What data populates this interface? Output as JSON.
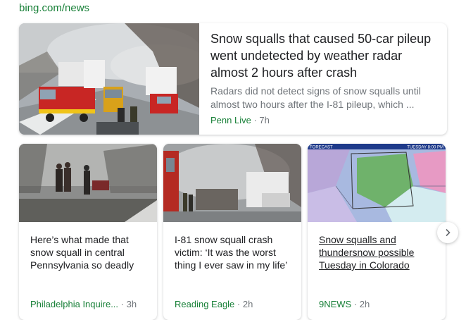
{
  "source_url": "bing.com/news",
  "main_story": {
    "title": "Snow squalls that caused 50-car pileup went undetected by weather radar almost 2 hours after crash",
    "snippet": "Radars did not detect signs of snow squalls until almost two hours after the I-81 pileup, which ...",
    "publisher": "Penn Live",
    "separator": " · ",
    "age": "7h",
    "image": "emergency vehicles at highway pileup in smoke"
  },
  "stories": [
    {
      "title": "Here’s what made that snow squall in central Pennsylvania so deadly",
      "publisher": "Philadelphia Inquire...",
      "separator": " · ",
      "age": "3h",
      "image": "people walking through blizzard"
    },
    {
      "title": "I-81 snow squall crash victim: ‘It was the worst thing I ever saw in my life’",
      "publisher": "Reading Eagle",
      "separator": " · ",
      "age": "2h",
      "image": "wrecked trucks in smoke"
    },
    {
      "title": "Snow squalls and thundersnow possible Tuesday in Colorado",
      "publisher": "9NEWS",
      "separator": " · ",
      "age": "2h",
      "image": "weather radar forecast map",
      "map_header_left": "FORECAST",
      "map_header_right": "TUESDAY 8:00 PM"
    }
  ],
  "next_icon": "chevron-right-icon",
  "colors": {
    "publisher": "#188038",
    "meta": "#70757a",
    "title": "#202124"
  }
}
